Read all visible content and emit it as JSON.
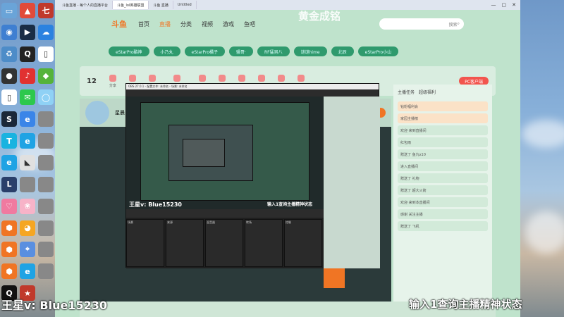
{
  "browser": {
    "tabs": [
      "斗鱼直播 - 每个人的直播平台",
      "斗鱼_lol英雄联盟",
      "斗鱼 直播",
      "Untitled"
    ],
    "active_tab": 1
  },
  "site": {
    "logo": "斗鱼",
    "page_title": "黄金成铭",
    "nav": [
      "首页",
      "直播",
      "分类",
      "视频",
      "游戏",
      "鱼吧"
    ],
    "search_placeholder": "搜索",
    "pills": [
      "eStarPro酷神",
      "小乃丸",
      "eStarPro橘子",
      "骚哥·",
      "RF猛男八",
      "谜谜hime",
      "北辰",
      "eStarPro小山"
    ],
    "toolbar": {
      "count": "12",
      "items": [
        "分享",
        "赠送",
        "礼物",
        "超级粉丝团",
        "弹幕",
        "贵族",
        "红包",
        "打卡",
        "鱼丸",
        "更多"
      ],
      "pc_button": "PC客户端"
    },
    "streamer": {
      "name": "星晨",
      "follow_label": "关注"
    },
    "sidebar": {
      "tabs": [
        "主播任务",
        "超级福利"
      ],
      "items": [
        "钻粉福利会",
        "家园主播榜",
        "欢迎 来到直播间",
        "红包雨",
        "赠送了 鱼丸x10",
        "进入直播间",
        "赠送了 礼物",
        "赠送了 超大火箭",
        "欢迎 来到本直播间",
        "感谢 关注主播",
        "赠送了 飞机"
      ]
    }
  },
  "obs": {
    "title": "OBS 27.0.1 - 配置文件: 未命名 - 场景: 未命名",
    "inner_caption_left": "王星v: Blue15230",
    "inner_caption_right": "输入1查询主播精神状态",
    "panels": [
      "场景",
      "来源",
      "混音器",
      "转场",
      "控制"
    ]
  },
  "overlay": {
    "left": "王星v: Blue15230",
    "right": "输入1查询主播精神状态"
  },
  "desktop": {
    "icons": [
      {
        "name": "computer-icon",
        "color": "#6aa4d8",
        "glyph": "▭"
      },
      {
        "name": "app-icon",
        "color": "#e14a3a",
        "glyph": "▲"
      },
      {
        "name": "game-icon",
        "color": "#c0392b",
        "glyph": "七"
      },
      {
        "name": "network-icon",
        "color": "#3f7fd1",
        "glyph": "◉"
      },
      {
        "name": "video-icon",
        "color": "#1a2d46",
        "glyph": "▶"
      },
      {
        "name": "cloud-icon",
        "color": "#2b82e0",
        "glyph": "☁"
      },
      {
        "name": "recycle-icon",
        "color": "#4d8cc8",
        "glyph": "♻"
      },
      {
        "name": "tool-icon",
        "color": "#222",
        "glyph": "Q"
      },
      {
        "name": "doc-icon",
        "color": "#fff",
        "glyph": "▯"
      },
      {
        "name": "obs-icon",
        "color": "#333",
        "glyph": "●"
      },
      {
        "name": "music-icon",
        "color": "#e13131",
        "glyph": "♪"
      },
      {
        "name": "game2-icon",
        "color": "#55b33a",
        "glyph": "◆"
      },
      {
        "name": "file-icon",
        "color": "#fff",
        "glyph": "▯"
      },
      {
        "name": "wechat-icon",
        "color": "#2dc84d",
        "glyph": "✉"
      },
      {
        "name": "bubble-icon",
        "color": "#8fd1f5",
        "glyph": "◯"
      },
      {
        "name": "steam-icon",
        "color": "#1b2838",
        "glyph": "S"
      },
      {
        "name": "browser-icon",
        "color": "#3a85e8",
        "glyph": "e"
      },
      {
        "name": "blank-icon",
        "color": "#888",
        "glyph": ""
      },
      {
        "name": "store-icon",
        "color": "#1ab3e0",
        "glyph": "T"
      },
      {
        "name": "edge-icon",
        "color": "#1fa3e4",
        "glyph": "e"
      },
      {
        "name": "blank2-icon",
        "color": "#888",
        "glyph": ""
      },
      {
        "name": "edge2-icon",
        "color": "#1fa3e4",
        "glyph": "e"
      },
      {
        "name": "game3-icon",
        "color": "#e0e0e0",
        "glyph": "◣"
      },
      {
        "name": "blank3-icon",
        "color": "#888",
        "glyph": ""
      },
      {
        "name": "lol-icon",
        "color": "#2a3f6a",
        "glyph": "L"
      },
      {
        "name": "blank4-icon",
        "color": "#888",
        "glyph": ""
      },
      {
        "name": "blank5-icon",
        "color": "#888",
        "glyph": ""
      },
      {
        "name": "pink-icon",
        "color": "#f07aa0",
        "glyph": "♡"
      },
      {
        "name": "pink2-icon",
        "color": "#f7b3c8",
        "glyph": "❀"
      },
      {
        "name": "blank6-icon",
        "color": "#888",
        "glyph": ""
      },
      {
        "name": "orange-icon",
        "color": "#f07524",
        "glyph": "⬢"
      },
      {
        "name": "owl-icon",
        "color": "#f5a623",
        "glyph": "◕"
      },
      {
        "name": "blank7-icon",
        "color": "#888",
        "glyph": ""
      },
      {
        "name": "orange2-icon",
        "color": "#f07524",
        "glyph": "⬢"
      },
      {
        "name": "map-icon",
        "color": "#5a8fe0",
        "glyph": "⌖"
      },
      {
        "name": "blank8-icon",
        "color": "#888",
        "glyph": ""
      },
      {
        "name": "orange3-icon",
        "color": "#f07524",
        "glyph": "⬢"
      },
      {
        "name": "edge3-icon",
        "color": "#1fa3e4",
        "glyph": "e"
      },
      {
        "name": "blank9-icon",
        "color": "#888",
        "glyph": ""
      },
      {
        "name": "qq-icon",
        "color": "#111",
        "glyph": "Q"
      },
      {
        "name": "game4-icon",
        "color": "#c0392b",
        "glyph": "★"
      }
    ]
  }
}
